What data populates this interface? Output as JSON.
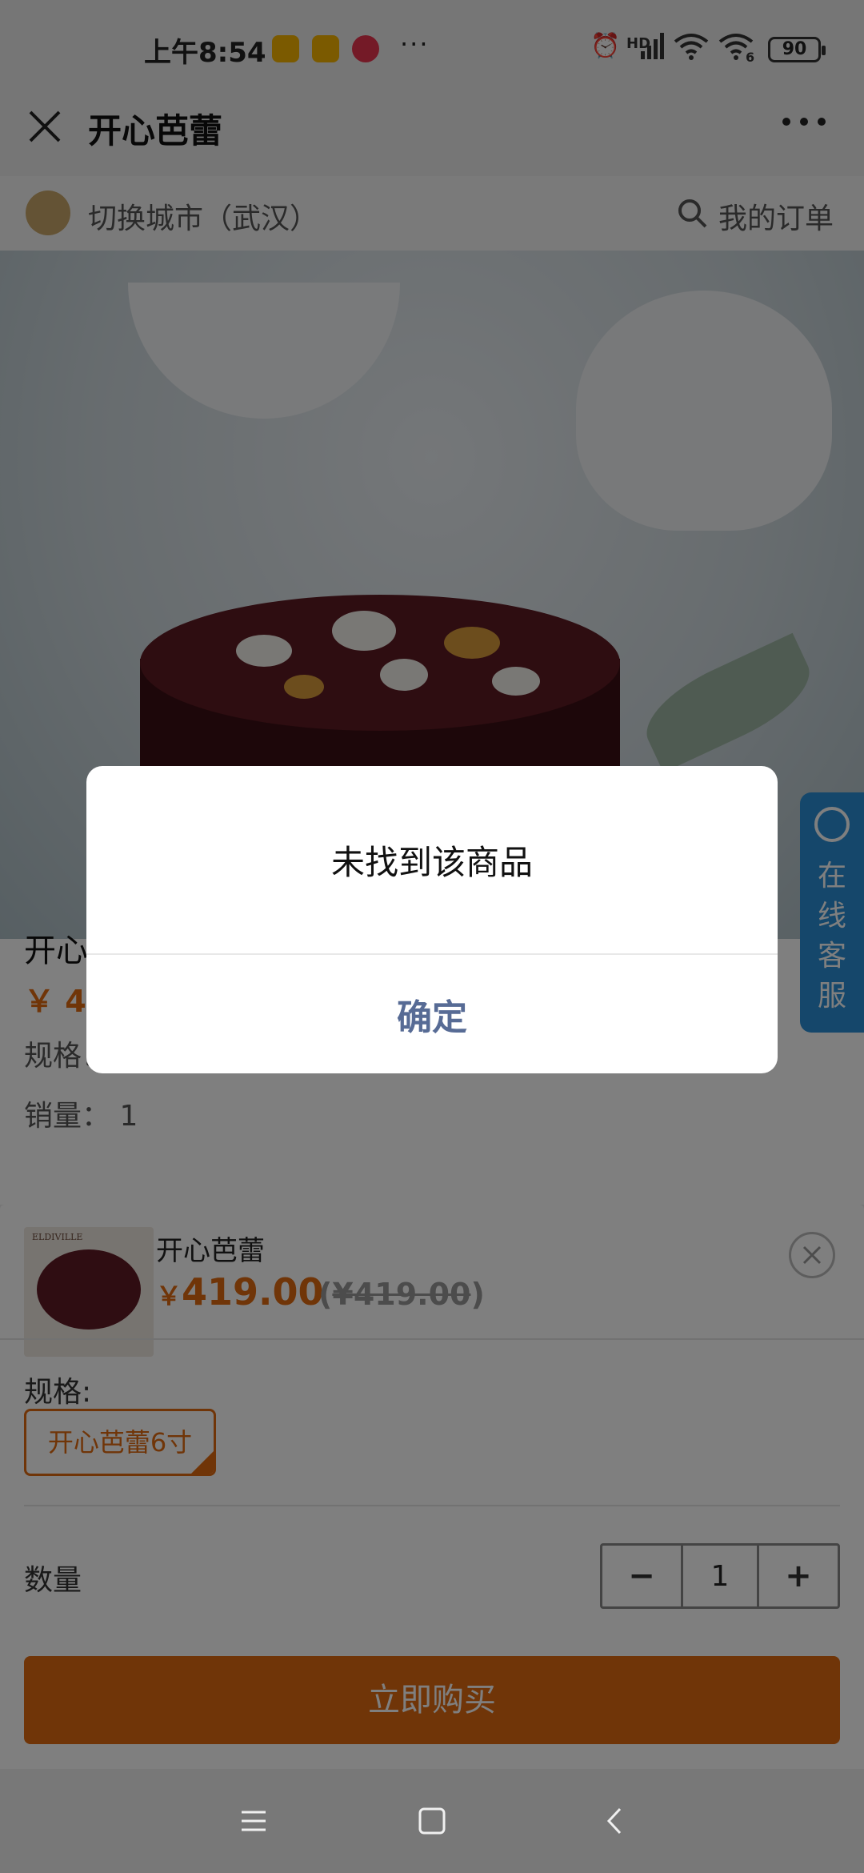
{
  "status_bar": {
    "time": "上午8:54",
    "more": "···",
    "network": "HD",
    "wifi_badge": "6",
    "battery": "90"
  },
  "nav": {
    "title": "开心芭蕾"
  },
  "page": {
    "city": "切换城市（武汉）",
    "orders": "我的订单",
    "customer_service": "在线客服",
    "product_name": "开心芭蕾",
    "price_prefix": "￥ 4",
    "spec_row": "规格：    开心芭蕾6寸",
    "sales_row": "销量：    1"
  },
  "sheet": {
    "brand": "ELDIVILLE",
    "name": "开心芭蕾",
    "currency": "￥",
    "price": "419.00",
    "orig_open": "(",
    "orig_price": "¥419.00",
    "orig_close": ")",
    "spec_label": "规格:",
    "spec_option": "开心芭蕾6寸",
    "qty_label": "数量",
    "qty_minus": "−",
    "qty_value": "1",
    "qty_plus": "+",
    "buy_label": "立即购买"
  },
  "dialog": {
    "message": "未找到该商品",
    "confirm": "确定"
  },
  "colors": {
    "accent": "#e06a10",
    "dialog_button": "#576b95",
    "kefu": "#2a8fd6"
  }
}
